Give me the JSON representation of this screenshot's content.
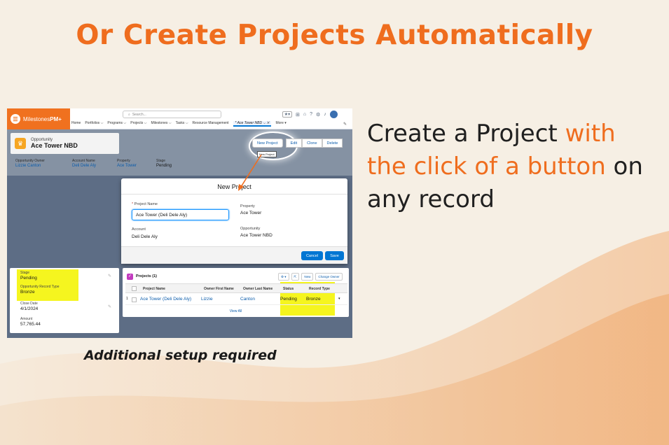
{
  "slide": {
    "title": "Or Create Projects Automatically",
    "caption_part1": "Create a Project ",
    "caption_highlight": "with the click of a button",
    "caption_part2": " on any record",
    "note": "Additional setup required",
    "accent_color": "#ef6d1e"
  },
  "app": {
    "brand_icon": "milestones-logo-icon",
    "brand_name": "Milestones",
    "brand_suffix": "PM+",
    "search_placeholder": "Search...",
    "nav": [
      "Home",
      "Portfolios ⌵",
      "Programs ⌵",
      "Projects ⌵",
      "Milestones ⌵",
      "Tasks ⌵",
      "Resource Management"
    ],
    "active_tab": "* Ace Tower NBD ⌵ ✕",
    "more_tab": "More ▾"
  },
  "record": {
    "type": "Opportunity",
    "name": "Ace Tower NBD",
    "actions": {
      "new_project": "New Project",
      "edit": "Edit",
      "clone": "Clone",
      "delete": "Delete"
    },
    "tooltip": "New Project",
    "fields": {
      "owner_label": "Opportunity Owner",
      "owner_value": "Lizzie Canton",
      "account_label": "Account Name",
      "account_value": "Deli Dele Aly",
      "property_label": "Property",
      "property_value": "Ace Tower",
      "stage_label": "Stage",
      "stage_value": "Pending"
    }
  },
  "modal": {
    "title": "New Project",
    "project_name_label": "Project Name",
    "project_name_required": "*",
    "project_name_value": "Ace Tower (Deli Dele Aly)",
    "property_label": "Property",
    "property_value": "Ace Tower",
    "account_label": "Account",
    "account_value": "Deli Dele Aly",
    "opportunity_label": "Opportunity",
    "opportunity_value": "Ace Tower NBD",
    "cancel_label": "Cancel",
    "save_label": "Save"
  },
  "details": {
    "stage_label": "Stage",
    "stage_value": "Pending",
    "record_type_label": "Opportunity Record Type",
    "record_type_value": "Bronze",
    "close_date_label": "Close Date",
    "close_date_value": "4/1/2024",
    "amount_label": "Amount",
    "amount_value": "57,765.44"
  },
  "projects": {
    "title": "Projects (1)",
    "buttons": {
      "gear": "⚙ ▾",
      "popout": "⇱",
      "new": "New",
      "change_owner": "Change Owner"
    },
    "columns": [
      "Project Name",
      "Owner First Name",
      "Owner Last Name",
      "Status",
      "Record Type"
    ],
    "rows": [
      {
        "num": "1",
        "project_name": "Ace Tower (Deli Dele Aly)",
        "owner_first": "Lizzie",
        "owner_last": "Canton",
        "status": "Pending",
        "record_type": "Bronze"
      }
    ],
    "view_all": "View All"
  }
}
